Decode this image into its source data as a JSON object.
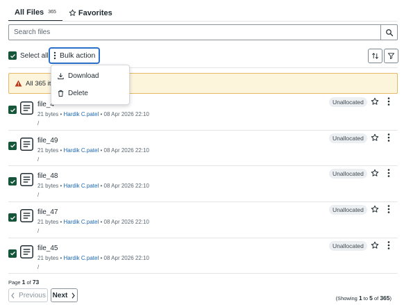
{
  "tabs": {
    "all_files_label": "All Files",
    "all_files_count": "365",
    "favorites_label": "Favorites"
  },
  "search": {
    "placeholder": "Search files",
    "icon": "search-icon"
  },
  "controls": {
    "select_all_label": "Select all",
    "bulk_action_label": "Bulk action",
    "sort_icon": "sort-arrows-icon",
    "filter_icon": "filter-icon"
  },
  "bulk_menu": {
    "items": [
      {
        "label": "Download",
        "icon": "download-icon"
      },
      {
        "label": "Delete",
        "icon": "trash-icon"
      }
    ]
  },
  "banner": {
    "text": "All 365 ite",
    "icon": "warning-icon"
  },
  "files": [
    {
      "name": "file_4",
      "size": "21 bytes",
      "author": "Hardik C.patel",
      "date": "08 Apr 2026 22:10",
      "path": "/",
      "status": "Unallocated"
    },
    {
      "name": "file_49",
      "size": "21 bytes",
      "author": "Hardik C.patel",
      "date": "08 Apr 2026 22:10",
      "path": "/",
      "status": "Unallocated"
    },
    {
      "name": "file_48",
      "size": "21 bytes",
      "author": "Hardik C.patel",
      "date": "08 Apr 2026 22:10",
      "path": "/",
      "status": "Unallocated"
    },
    {
      "name": "file_47",
      "size": "21 bytes",
      "author": "Hardik C.patel",
      "date": "08 Apr 2026 22:10",
      "path": "/",
      "status": "Unallocated"
    },
    {
      "name": "file_45",
      "size": "21 bytes",
      "author": "Hardik C.patel",
      "date": "08 Apr 2026 22:10",
      "path": "/",
      "status": "Unallocated"
    }
  ],
  "meta_separator": "•",
  "pagination": {
    "page_word": "Page",
    "current_page": "1",
    "of_word": "of",
    "total_pages": "73",
    "prev_label": "Previous",
    "next_label": "Next",
    "showing_word": "(Showing",
    "range_start": "1",
    "to_word": "to",
    "range_end": "5",
    "total_items": "365",
    "close_paren": ")"
  },
  "colors": {
    "checkbox": "#15553a",
    "focus_border": "#2a6fc9",
    "banner_bg": "#fdf4dc",
    "banner_border": "#e3b866",
    "warning_icon": "#b83c1c",
    "link": "#1b66b3"
  }
}
